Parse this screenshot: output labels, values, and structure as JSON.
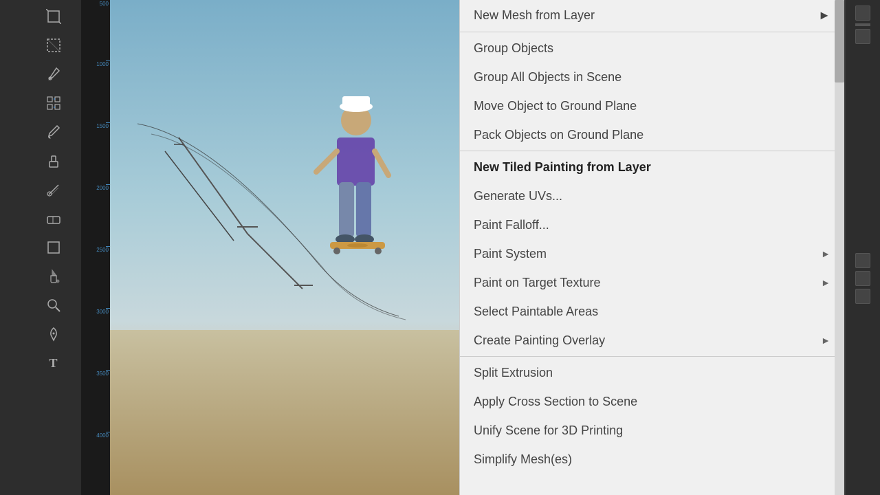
{
  "toolbar": {
    "tools": [
      {
        "name": "crop-tool",
        "icon": "⬜",
        "label": "Crop"
      },
      {
        "name": "transform-tool",
        "icon": "✕",
        "label": "Transform"
      },
      {
        "name": "eyedropper-tool",
        "icon": "✒",
        "label": "Eyedropper"
      },
      {
        "name": "grid-tool",
        "icon": "⊞",
        "label": "Grid"
      },
      {
        "name": "brush-tool",
        "icon": "🖌",
        "label": "Brush"
      },
      {
        "name": "stamp-tool",
        "icon": "⬟",
        "label": "Stamp"
      },
      {
        "name": "smudge-tool",
        "icon": "✦",
        "label": "Smudge"
      },
      {
        "name": "eraser-tool",
        "icon": "◻",
        "label": "Eraser"
      },
      {
        "name": "rect-select-tool",
        "icon": "▣",
        "label": "Rectangle Select"
      },
      {
        "name": "fill-tool",
        "icon": "◉",
        "label": "Fill"
      },
      {
        "name": "zoom-tool",
        "icon": "🔍",
        "label": "Zoom"
      },
      {
        "name": "pen-tool",
        "icon": "✎",
        "label": "Pen"
      },
      {
        "name": "text-tool",
        "icon": "T",
        "label": "Text"
      }
    ]
  },
  "context_menu": {
    "items": [
      {
        "id": "new-mesh-from-layer",
        "label": "New Mesh from Layer",
        "bold": false,
        "has_arrow": true,
        "separator_after": false
      },
      {
        "id": "group-objects",
        "label": "Group Objects",
        "bold": false,
        "has_arrow": false,
        "separator_after": false
      },
      {
        "id": "group-all-objects",
        "label": "Group All Objects in Scene",
        "bold": false,
        "has_arrow": false,
        "separator_after": false
      },
      {
        "id": "move-object-ground",
        "label": "Move Object to Ground Plane",
        "bold": false,
        "has_arrow": false,
        "separator_after": false
      },
      {
        "id": "pack-objects-ground",
        "label": "Pack Objects on Ground Plane",
        "bold": false,
        "has_arrow": false,
        "separator_after": true
      },
      {
        "id": "new-tiled-painting",
        "label": "New Tiled Painting from Layer",
        "bold": true,
        "has_arrow": false,
        "separator_after": false
      },
      {
        "id": "generate-uvs",
        "label": "Generate UVs...",
        "bold": false,
        "has_arrow": false,
        "separator_after": false
      },
      {
        "id": "paint-falloff",
        "label": "Paint Falloff...",
        "bold": false,
        "has_arrow": false,
        "separator_after": false
      },
      {
        "id": "paint-system",
        "label": "Paint System",
        "bold": false,
        "has_arrow": true,
        "separator_after": false
      },
      {
        "id": "paint-on-target",
        "label": "Paint on Target Texture",
        "bold": false,
        "has_arrow": true,
        "separator_after": false
      },
      {
        "id": "select-paintable",
        "label": "Select Paintable Areas",
        "bold": false,
        "has_arrow": false,
        "separator_after": false
      },
      {
        "id": "create-painting-overlay",
        "label": "Create Painting Overlay",
        "bold": false,
        "has_arrow": true,
        "separator_after": true
      },
      {
        "id": "split-extrusion",
        "label": "Split Extrusion",
        "bold": false,
        "has_arrow": false,
        "separator_after": false
      },
      {
        "id": "apply-cross-section",
        "label": "Apply Cross Section to Scene",
        "bold": false,
        "has_arrow": false,
        "separator_after": false
      },
      {
        "id": "unify-scene-3d",
        "label": "Unify Scene for 3D Printing",
        "bold": false,
        "has_arrow": false,
        "separator_after": false
      },
      {
        "id": "simplify-meshes",
        "label": "Simplify Mesh(es)",
        "bold": false,
        "has_arrow": false,
        "separator_after": false
      }
    ]
  },
  "ruler": {
    "ticks": [
      "500",
      "1000",
      "1500",
      "2000",
      "2500",
      "3000",
      "3500",
      "4000"
    ]
  }
}
